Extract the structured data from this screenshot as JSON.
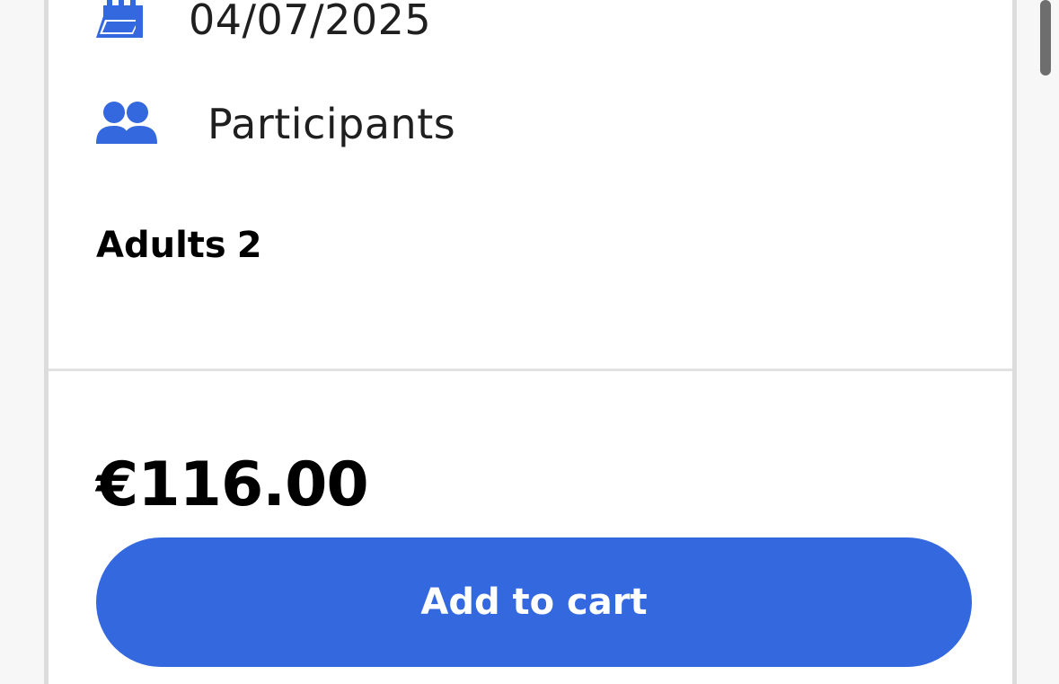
{
  "booking": {
    "date": "04/07/2025",
    "participants_label": "Participants",
    "adults_label": "Adults",
    "adults_count": "2"
  },
  "pricing": {
    "total": "€116.00"
  },
  "actions": {
    "add_to_cart_label": "Add to cart"
  },
  "icons": {
    "date": "calendar-icon",
    "participants": "users-icon"
  },
  "colors": {
    "accent": "#3468de",
    "text": "#1f1f1f",
    "divider": "#e2e2e2"
  }
}
